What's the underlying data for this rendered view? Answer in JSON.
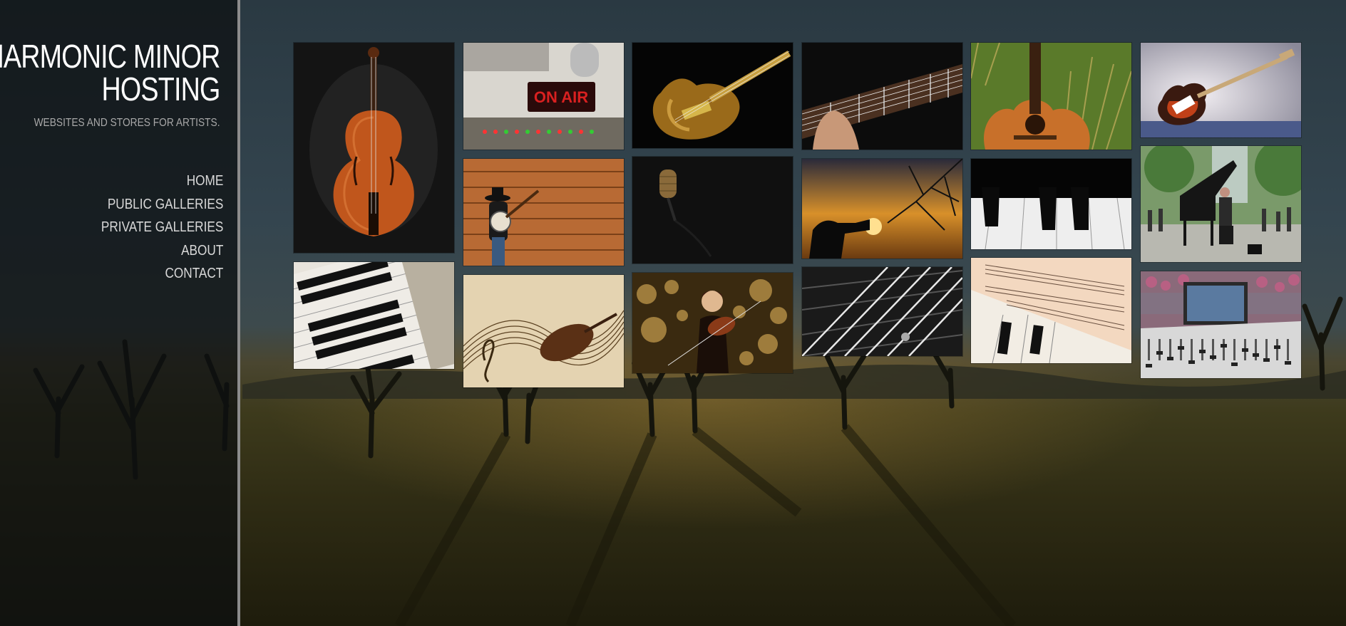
{
  "site": {
    "title_line1": "HARMONIC MINOR",
    "title_line2": "HOSTING",
    "tagline": "WEBSITES AND STORES FOR ARTISTS."
  },
  "nav": {
    "items": [
      {
        "label": "HOME"
      },
      {
        "label": "PUBLIC GALLERIES"
      },
      {
        "label": "PRIVATE GALLERIES"
      },
      {
        "label": "ABOUT"
      },
      {
        "label": "CONTACT"
      }
    ]
  },
  "gallery": {
    "tiles": [
      {
        "subject": "cello"
      },
      {
        "subject": "on-air-studio",
        "sign_text": "ON AIR"
      },
      {
        "subject": "electric-guitar-gold"
      },
      {
        "subject": "guitar-fretboard-hand"
      },
      {
        "subject": "acoustic-guitar-grass"
      },
      {
        "subject": "stratocaster"
      },
      {
        "subject": "banjo-player"
      },
      {
        "subject": "microphone-dark"
      },
      {
        "subject": "trumpet-sunset"
      },
      {
        "subject": "piano-keys-closeup"
      },
      {
        "subject": "street-piano"
      },
      {
        "subject": "piano-keys-wood"
      },
      {
        "subject": "sheet-music-violin"
      },
      {
        "subject": "violinist-bokeh"
      },
      {
        "subject": "guitar-strings-bw"
      },
      {
        "subject": "sheet-music-piano"
      },
      {
        "subject": "mixing-console"
      }
    ]
  }
}
